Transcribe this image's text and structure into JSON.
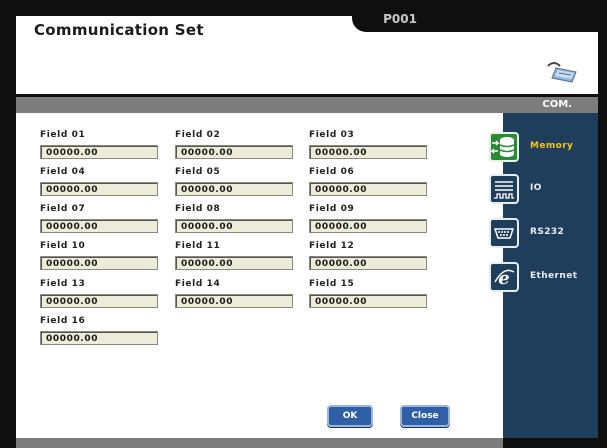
{
  "header": {
    "title": "Communication Set",
    "page_id": "P001",
    "device_icon": "serial-plug-icon"
  },
  "bar": {
    "label": "COM."
  },
  "fields": [
    {
      "label": "Field  01",
      "value": "00000.00"
    },
    {
      "label": "Field  02",
      "value": "00000.00"
    },
    {
      "label": "Field  03",
      "value": "00000.00"
    },
    {
      "label": "Field  04",
      "value": "00000.00"
    },
    {
      "label": "Field  05",
      "value": "00000.00"
    },
    {
      "label": "Field  06",
      "value": "00000.00"
    },
    {
      "label": "Field  07",
      "value": "00000.00"
    },
    {
      "label": "Field  08",
      "value": "00000.00"
    },
    {
      "label": "Field  09",
      "value": "00000.00"
    },
    {
      "label": "Field  10",
      "value": "00000.00"
    },
    {
      "label": "Field  11",
      "value": "00000.00"
    },
    {
      "label": "Field  12",
      "value": "00000.00"
    },
    {
      "label": "Field  13",
      "value": "00000.00"
    },
    {
      "label": "Field  14",
      "value": "00000.00"
    },
    {
      "label": "Field  15",
      "value": "00000.00"
    },
    {
      "label": "Field  16",
      "value": "00000.00"
    }
  ],
  "sidebar": {
    "items": [
      {
        "label": "Memory",
        "icon": "memory-icon",
        "active": true
      },
      {
        "label": "IO",
        "icon": "io-icon",
        "active": false
      },
      {
        "label": "RS232",
        "icon": "rs232-icon",
        "active": false
      },
      {
        "label": "Ethernet",
        "icon": "ethernet-icon",
        "active": false
      }
    ]
  },
  "buttons": {
    "ok": "OK",
    "close": "Close"
  },
  "colors": {
    "frame": "#0f0f0f",
    "bar": "#7c7c7c",
    "sidebar": "#1f3e5c",
    "active_label": "#f3c51b",
    "field_bg": "#ececd8",
    "button": "#2f5fa7"
  }
}
